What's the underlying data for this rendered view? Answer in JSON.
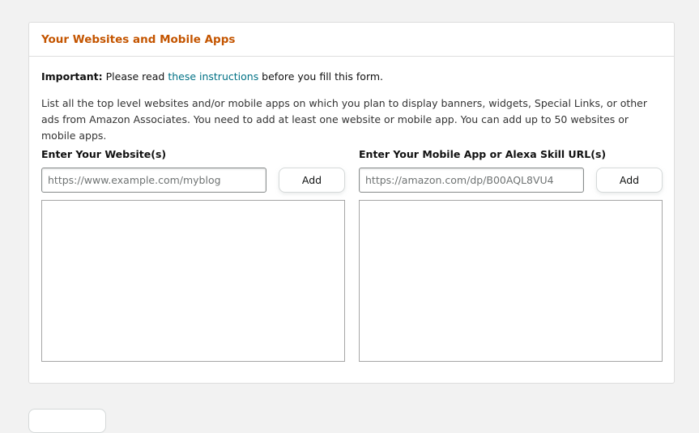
{
  "section": {
    "title": "Your Websites and Mobile Apps"
  },
  "notice": {
    "important_label": "Important:",
    "text_before_link": " Please read ",
    "link_text": "these instructions",
    "text_after_link": " before you fill this form."
  },
  "description": "List all the top level websites and/or mobile apps on which you plan to display banners, widgets, Special Links, or other ads from Amazon Associates. You need to add at least one website or mobile app. You can add up to 50 websites or mobile apps.",
  "websites": {
    "label": "Enter Your Website(s)",
    "input_value": "",
    "placeholder": "https://www.example.com/myblog",
    "add_label": "Add",
    "items": []
  },
  "mobile_apps": {
    "label": "Enter Your Mobile App or Alexa Skill URL(s)",
    "input_value": "",
    "placeholder": "https://amazon.com/dp/B00AQL8VU4",
    "add_label": "Add",
    "items": []
  },
  "colors": {
    "title": "#c45500",
    "link": "#007185",
    "page_background": "#f2f2f2"
  }
}
